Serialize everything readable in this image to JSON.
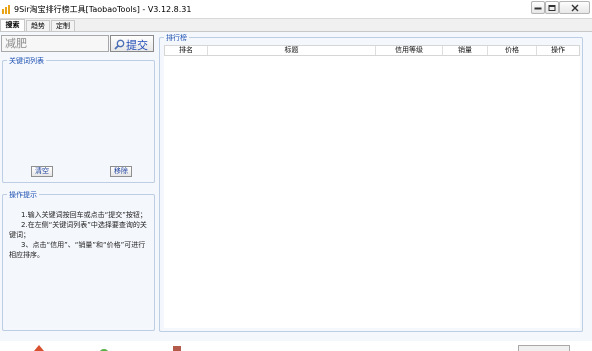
{
  "window": {
    "title": "9Sir淘宝排行榜工具[TaobaoTools] - V3.12.8.31"
  },
  "tabs": [
    {
      "label": "搜索",
      "active": true
    },
    {
      "label": "趋势",
      "active": false
    },
    {
      "label": "定制",
      "active": false
    }
  ],
  "search": {
    "value": "减肥",
    "submit_label": "提交"
  },
  "keyword_list": {
    "title": "关键词列表",
    "clear_label": "清空",
    "remove_label": "移除"
  },
  "tips": {
    "title": "操作提示",
    "lines": [
      "1.输入关键词按回车或点击“提交”按钮；",
      "2.在左侧“关键词列表”中选择要查询的关键词；",
      "3、点击“信用”、“销量”和“价格”可进行相应排序。"
    ]
  },
  "ranking": {
    "title": "排行榜",
    "columns": [
      "排名",
      "标题",
      "信用等级",
      "销量",
      "价格",
      "操作"
    ]
  },
  "colors": {
    "legend_text": "#1a4eb0",
    "panel_bg": "#f4f7fc",
    "group_border": "#bccde4"
  }
}
